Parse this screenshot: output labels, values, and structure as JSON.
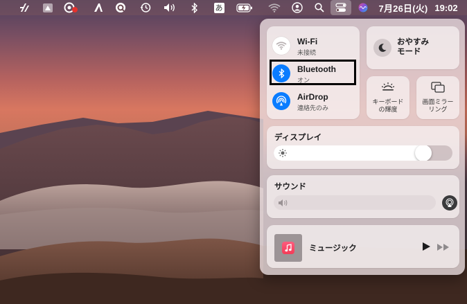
{
  "menubar": {
    "icons": [
      "affinity-icon",
      "drive-icon",
      "creative-cloud-icon",
      "script-a-icon",
      "quicktime-icon",
      "time-machine-icon",
      "volume-icon",
      "bluetooth-icon",
      "input-method-icon",
      "battery-icon",
      "wifi-icon",
      "user-icon",
      "spotlight-icon",
      "control-center-icon",
      "siri-icon"
    ],
    "input_method_label": "あ",
    "date": "7月26日(火)",
    "time": "19:02"
  },
  "control_center": {
    "network": {
      "wifi": {
        "title": "Wi-Fi",
        "status": "未接続",
        "icon": "wifi-icon",
        "active": false
      },
      "bluetooth": {
        "title": "Bluetooth",
        "status": "オン",
        "icon": "bluetooth-icon",
        "active": true
      },
      "airdrop": {
        "title": "AirDrop",
        "status": "連絡先のみ",
        "icon": "airdrop-icon",
        "active": true
      }
    },
    "focus": {
      "line1": "おやすみ",
      "line2": "モード",
      "icon": "moon-icon"
    },
    "keyboard_brightness": {
      "line1": "キーボード",
      "line2": "の輝度",
      "icon": "keyboard-brightness-icon"
    },
    "screen_mirroring": {
      "line1": "画面ミラー",
      "line2": "リング",
      "icon": "screen-mirroring-icon"
    },
    "display": {
      "label": "ディスプレイ",
      "level": 0.87,
      "icon": "sun-icon"
    },
    "sound": {
      "label": "サウンド",
      "level": 0.0,
      "icon": "speaker-icon",
      "airplay_icon": "airplay-icon"
    },
    "music": {
      "title": "ミュージック",
      "icon": "music-icon",
      "play_icon": "play-icon",
      "forward_icon": "fast-forward-icon"
    }
  },
  "colors": {
    "accent_blue": "#0a7cff",
    "highlight_border": "#000000"
  }
}
